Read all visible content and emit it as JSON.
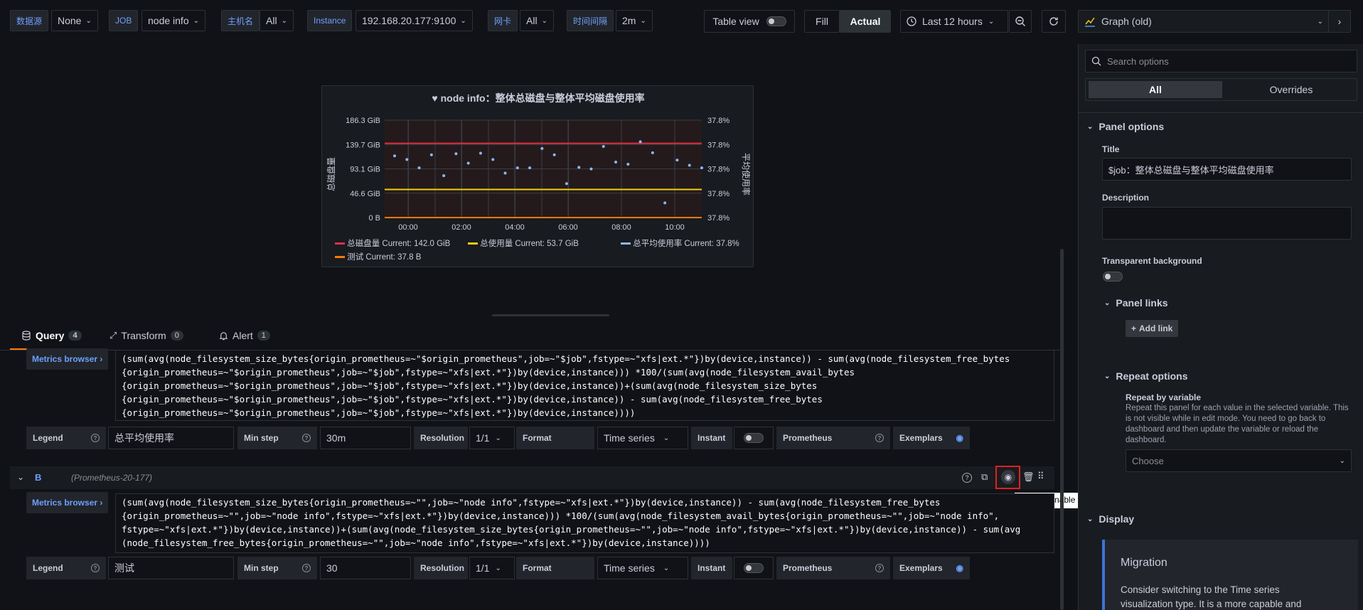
{
  "variables": [
    {
      "label": "数据源",
      "value": "None"
    },
    {
      "label": "JOB",
      "value": "node info"
    },
    {
      "label": "主机名",
      "value": "All"
    },
    {
      "label": "Instance",
      "value": "192.168.20.177:9100"
    },
    {
      "label": "网卡",
      "value": "All"
    },
    {
      "label": "时间间隔",
      "value": "2m"
    }
  ],
  "toolbar": {
    "table_view": "Table view",
    "fill": "Fill",
    "actual": "Actual",
    "time_range": "Last 12 hours",
    "viz": "Graph (old)"
  },
  "colors": {
    "accent": "#6e9fff",
    "red": "#e02f44",
    "yellow": "#f2cc0c",
    "cyan": "#8ab8ff",
    "orange": "#ff780a"
  },
  "chart_data": {
    "type": "line",
    "title": "node info：整体总磁盘与整体平均磁盘使用率",
    "ylabel_left": "总磁盘量",
    "ylabel_right": "平均使用率",
    "y_ticks_left": [
      "186.3 GiB",
      "139.7 GiB",
      "93.1 GiB",
      "46.6 GiB",
      "0 B"
    ],
    "y_ticks_right": [
      "37.8%",
      "37.8%",
      "37.8%",
      "37.8%",
      "37.8%"
    ],
    "x_ticks": [
      "00:00",
      "02:00",
      "04:00",
      "06:00",
      "08:00",
      "10:00"
    ],
    "ylim_left": [
      0,
      186.3
    ],
    "series": [
      {
        "name": "总磁盘量",
        "legend_value": "Current: 142.0 GiB",
        "color": "#e02f44",
        "values": [
          142.0,
          142.0
        ]
      },
      {
        "name": "总使用量",
        "legend_value": "Current: 53.7 GiB",
        "color": "#f2cc0c",
        "values": [
          53.7,
          53.7
        ]
      },
      {
        "name": "总平均使用率",
        "legend_value": "Current: 37.8%",
        "color": "#8ab8ff",
        "points": [
          118,
          111,
          95,
          120,
          80,
          122,
          104,
          123,
          111,
          85,
          95,
          95,
          132,
          120,
          65,
          96,
          93,
          136,
          106,
          102,
          145,
          124,
          28,
          110,
          100,
          95
        ]
      },
      {
        "name": "测试",
        "legend_value": "Current: 37.8 B",
        "color": "#ff780a",
        "values": [
          0,
          0
        ]
      }
    ]
  },
  "tabs": [
    {
      "label": "Query",
      "count": "4"
    },
    {
      "label": "Transform",
      "count": "0"
    },
    {
      "label": "Alert",
      "count": "1"
    }
  ],
  "queryA": {
    "metrics_browser": "Metrics browser",
    "lines": [
      "(sum(avg(node_filesystem_size_bytes{origin_prometheus=~\"$origin_prometheus\",job=~\"$job\",fstype=~\"xfs|ext.*\"})by(device,instance)) - sum(avg(node_filesystem_free_bytes",
      "{origin_prometheus=~\"$origin_prometheus\",job=~\"$job\",fstype=~\"xfs|ext.*\"})by(device,instance))) *100/(sum(avg(node_filesystem_avail_bytes",
      "{origin_prometheus=~\"$origin_prometheus\",job=~\"$job\",fstype=~\"xfs|ext.*\"})by(device,instance))+(sum(avg(node_filesystem_size_bytes",
      "{origin_prometheus=~\"$origin_prometheus\",job=~\"$job\",fstype=~\"xfs|ext.*\"})by(device,instance)) - sum(avg(node_filesystem_free_bytes",
      "{origin_prometheus=~\"$origin_prometheus\",job=~\"$job\",fstype=~\"xfs|ext.*\"})by(device,instance))))"
    ],
    "legend_label": "Legend",
    "legend": "总平均使用率",
    "min_step_label": "Min step",
    "min_step": "30m",
    "resolution_label": "Resolution",
    "resolution": "1/1",
    "format_label": "Format",
    "format": "Time series",
    "instant_label": "Instant",
    "prometheus_label": "Prometheus",
    "exemplars_label": "Exemplars"
  },
  "queryB": {
    "letter": "B",
    "source": "(Prometheus-20-177)",
    "metrics_browser": "Metrics browser",
    "lines": [
      "(sum(avg(node_filesystem_size_bytes{origin_prometheus=~\"\",job=~\"node info\",fstype=~\"xfs|ext.*\"})by(device,instance)) - sum(avg(node_filesystem_free_bytes",
      "{origin_prometheus=~\"\",job=~\"node info\",fstype=~\"xfs|ext.*\"})by(device,instance))) *100/(sum(avg(node_filesystem_avail_bytes{origin_prometheus=~\"\",job=~\"node info\",",
      "fstype=~\"xfs|ext.*\"})by(device,instance))+(sum(avg(node_filesystem_size_bytes{origin_prometheus=~\"\",job=~\"node info\",fstype=~\"xfs|ext.*\"})by(device,instance)) - sum(avg",
      "(node_filesystem_free_bytes{origin_prometheus=~\"\",job=~\"node info\",fstype=~\"xfs|ext.*\"})by(device,instance))))"
    ],
    "legend_label": "Legend",
    "legend": "测试",
    "min_step_label": "Min step",
    "min_step": "30",
    "resolution_label": "Resolution",
    "resolution": "1/1",
    "format_label": "Format",
    "format": "Time series",
    "instant_label": "Instant",
    "prometheus_label": "Prometheus",
    "exemplars_label": "Exemplars",
    "tooltip": "Disable/enable query"
  },
  "options": {
    "search_placeholder": "Search options",
    "tab_all": "All",
    "tab_overrides": "Overrides",
    "panel_options": "Panel options",
    "title_label": "Title",
    "title_value": "$job：整体总磁盘与整体平均磁盘使用率",
    "description_label": "Description",
    "transparent_label": "Transparent background",
    "panel_links": "Panel links",
    "add_link": "Add link",
    "repeat_options": "Repeat options",
    "repeat_by": "Repeat by variable",
    "repeat_help": "Repeat this panel for each value in the selected variable. This is not visible while in edit mode. You need to go back to dashboard and then update the variable or reload the dashboard.",
    "choose": "Choose",
    "display": "Display",
    "migration_title": "Migration",
    "migration_text": "Consider switching to the Time series visualization type. It is a more capable and"
  }
}
